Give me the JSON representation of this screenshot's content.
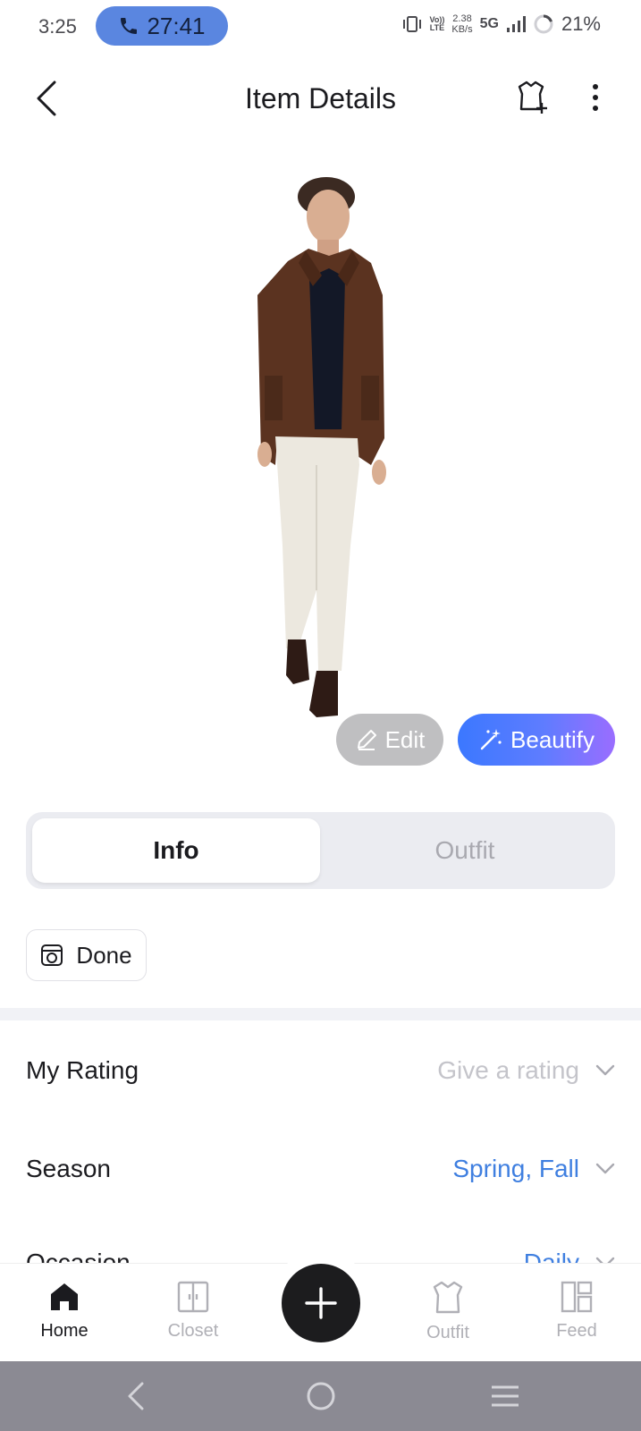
{
  "status_bar": {
    "time": "3:25",
    "call_timer": "27:41",
    "net_rate_value": "2.38",
    "net_rate_unit": "KB/s",
    "network_type": "5G",
    "volte_top": "Vo))",
    "volte_bottom": "LTE",
    "battery": "21%"
  },
  "header": {
    "title": "Item Details"
  },
  "image_actions": {
    "edit_label": "Edit",
    "beautify_label": "Beautify"
  },
  "tabs": [
    {
      "label": "Info",
      "active": true
    },
    {
      "label": "Outfit",
      "active": false
    }
  ],
  "status_chip": {
    "label": "Done"
  },
  "fields": [
    {
      "label": "My Rating",
      "value": "Give a rating",
      "state": "placeholder"
    },
    {
      "label": "Season",
      "value": "Spring, Fall",
      "state": "selected"
    },
    {
      "label": "Occasion",
      "value": "Daily",
      "state": "selected"
    }
  ],
  "bottom_nav": [
    {
      "label": "Home",
      "icon": "home-icon",
      "active": true
    },
    {
      "label": "Closet",
      "icon": "closet-icon",
      "active": false
    },
    {
      "label": "Outfit",
      "icon": "outfit-icon",
      "active": false
    },
    {
      "label": "Feed",
      "icon": "feed-icon",
      "active": false
    }
  ],
  "colors": {
    "accent_blue": "#3f7fe0",
    "call_pill": "#5a86e0",
    "beautify_start": "#3b78ff",
    "beautify_end": "#9a6dff",
    "fab": "#1c1c1e"
  }
}
